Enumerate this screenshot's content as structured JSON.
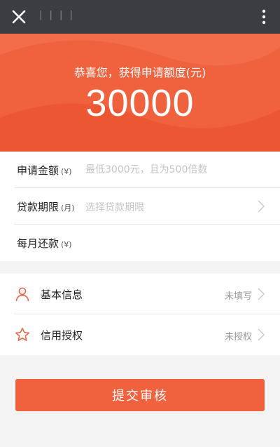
{
  "topbar": {
    "title": "| | | |"
  },
  "hero": {
    "subtitle": "恭喜您，获得申请额度(元)",
    "amount": "30000"
  },
  "form": {
    "amount": {
      "label": "申请金额",
      "unit": "(¥)",
      "placeholder": "最低3000元，且为500倍数"
    },
    "term": {
      "label": "贷款期限",
      "unit": "(月)",
      "placeholder": "选择贷款期限"
    },
    "monthly": {
      "label": "每月还款",
      "unit": "(¥)"
    }
  },
  "info": {
    "basic": {
      "label": "基本信息",
      "status": "未填写",
      "icon": "user-icon"
    },
    "credit": {
      "label": "信用授权",
      "status": "未授权",
      "icon": "star-icon"
    }
  },
  "submit": {
    "label": "提交审核"
  },
  "colors": {
    "accent": "#f0613e",
    "topbar": "#3b3d42"
  }
}
